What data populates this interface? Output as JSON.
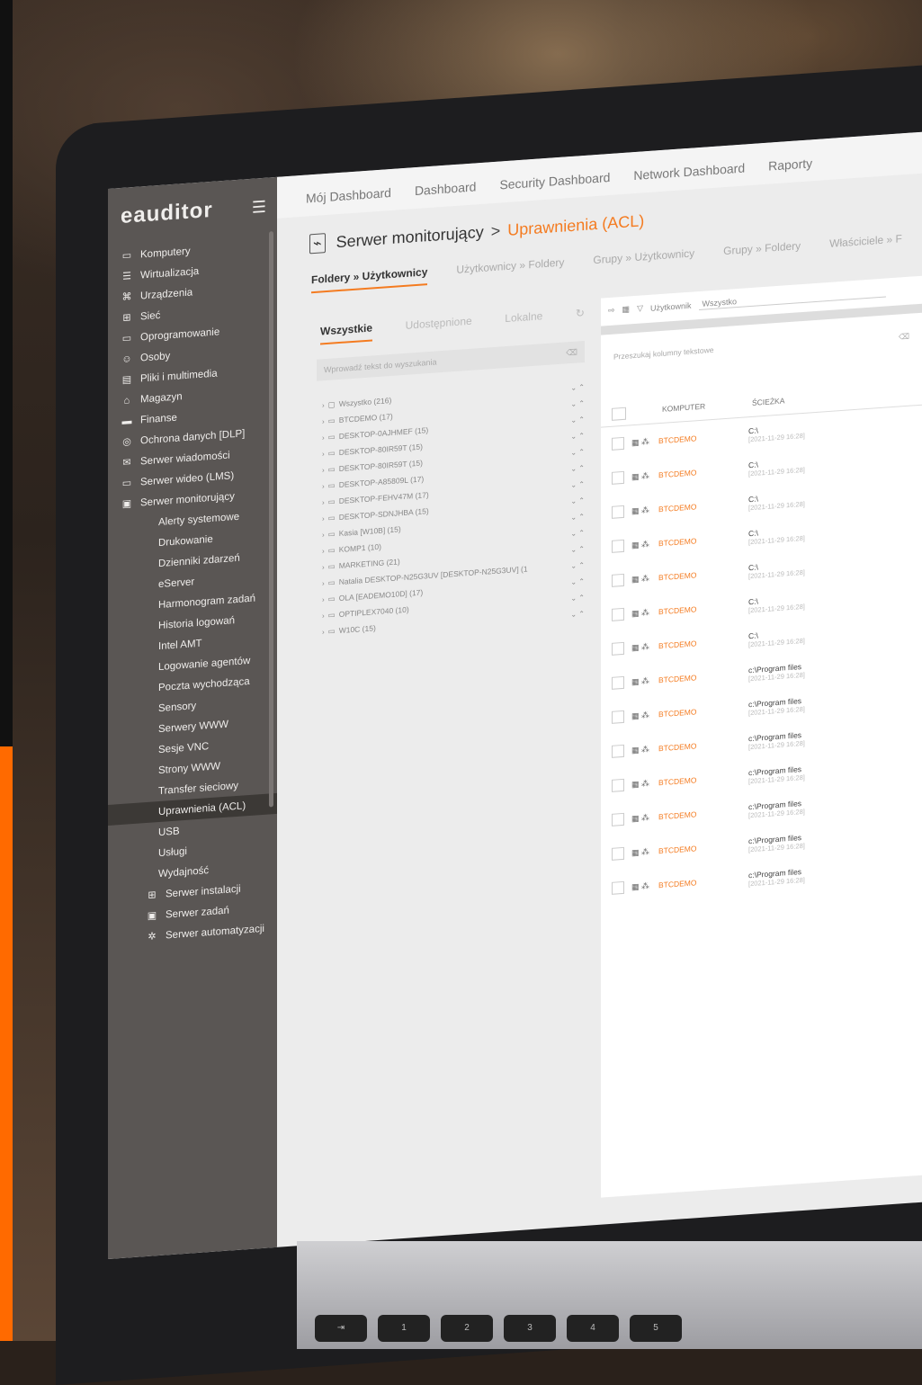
{
  "brand": {
    "name": "eauditor"
  },
  "sidebar": {
    "items": [
      {
        "label": "Komputery",
        "icon": "computer-icon",
        "glyph": "▭"
      },
      {
        "label": "Wirtualizacja",
        "icon": "server-icon",
        "glyph": "☰"
      },
      {
        "label": "Urządzenia",
        "icon": "devices-icon",
        "glyph": "⌘"
      },
      {
        "label": "Sieć",
        "icon": "network-icon",
        "glyph": "⊞"
      },
      {
        "label": "Oprogramowanie",
        "icon": "software-icon",
        "glyph": "▭"
      },
      {
        "label": "Osoby",
        "icon": "people-icon",
        "glyph": "☺"
      },
      {
        "label": "Pliki i multimedia",
        "icon": "files-icon",
        "glyph": "▤"
      },
      {
        "label": "Magazyn",
        "icon": "warehouse-icon",
        "glyph": "⌂"
      },
      {
        "label": "Finanse",
        "icon": "finance-icon",
        "glyph": "▬"
      },
      {
        "label": "Ochrona danych [DLP]",
        "icon": "shield-icon",
        "glyph": "◎"
      },
      {
        "label": "Serwer wiadomości",
        "icon": "mail-icon",
        "glyph": "✉"
      },
      {
        "label": "Serwer wideo (LMS)",
        "icon": "video-icon",
        "glyph": "▭"
      },
      {
        "label": "Serwer monitorujący",
        "icon": "monitor-icon",
        "glyph": "▣"
      }
    ],
    "sub_items": [
      "Alerty systemowe",
      "Drukowanie",
      "Dzienniki zdarzeń",
      "eServer",
      "Harmonogram zadań",
      "Historia logowań",
      "Intel AMT",
      "Logowanie agentów",
      "Poczta wychodząca",
      "Sensory",
      "Serwery WWW",
      "Sesje VNC",
      "Strony WWW",
      "Transfer sieciowy",
      "Uprawnienia (ACL)",
      "USB",
      "Usługi",
      "Wydajność"
    ],
    "active_sub": "Uprawnienia (ACL)",
    "tail_items": [
      {
        "label": "Serwer instalacji",
        "icon": "install-icon",
        "glyph": "⊞"
      },
      {
        "label": "Serwer zadań",
        "icon": "tasks-icon",
        "glyph": "▣"
      },
      {
        "label": "Serwer automatyzacji",
        "icon": "automation-icon",
        "glyph": "✲"
      }
    ]
  },
  "topnav": [
    "Mój Dashboard",
    "Dashboard",
    "Security Dashboard",
    "Network Dashboard",
    "Raporty"
  ],
  "page": {
    "section": "Serwer monitorujący",
    "separator": ">",
    "current": "Uprawnienia (ACL)"
  },
  "tabs": [
    "Foldery » Użytkownicy",
    "Użytkownicy » Foldery",
    "Grupy » Użytkownicy",
    "Grupy » Foldery",
    "Właściciele » F"
  ],
  "active_tab": 0,
  "left": {
    "subtabs": [
      "Wszystkie",
      "Udostępnione",
      "Lokalne"
    ],
    "search_placeholder": "Wprowadź tekst do wyszukania",
    "tree": [
      "Wszystko (216)",
      "BTCDEMO (17)",
      "DESKTOP-0AJHMEF (15)",
      "DESKTOP-80IR59T (15)",
      "DESKTOP-80IR59T (15)",
      "DESKTOP-A85809L (17)",
      "DESKTOP-FEHV47M (17)",
      "DESKTOP-SDNJHBA (15)",
      "Kasia [W10B] (15)",
      "KOMP1 (10)",
      "MARKETING (21)",
      "Natalia DESKTOP-N25G3UV [DESKTOP-N25G3UV] (1",
      "OLA [EADEMO10D] (17)",
      "OPTIPLEX7040 (10)",
      "W10C (15)"
    ]
  },
  "right": {
    "user_label": "Użytkownik",
    "user_value": "Wszystko",
    "search_placeholder": "Przeszukaj kolumny tekstowe",
    "columns": [
      "KOMPUTER",
      "ŚCIEŻKA"
    ],
    "rows": [
      {
        "computer": "BTCDEMO",
        "path": "C:\\",
        "date": "[2021-11-29 16:28]"
      },
      {
        "computer": "BTCDEMO",
        "path": "C:\\",
        "date": "[2021-11-29 16:28]"
      },
      {
        "computer": "BTCDEMO",
        "path": "C:\\",
        "date": "[2021-11-29 16:28]"
      },
      {
        "computer": "BTCDEMO",
        "path": "C:\\",
        "date": "[2021-11-29 16:28]"
      },
      {
        "computer": "BTCDEMO",
        "path": "C:\\",
        "date": "[2021-11-29 16:28]"
      },
      {
        "computer": "BTCDEMO",
        "path": "C:\\",
        "date": "[2021-11-29 16:28]"
      },
      {
        "computer": "BTCDEMO",
        "path": "C:\\",
        "date": "[2021-11-29 16:28]"
      },
      {
        "computer": "BTCDEMO",
        "path": "c:\\Program files",
        "date": "[2021-11-29 16:28]"
      },
      {
        "computer": "BTCDEMO",
        "path": "c:\\Program files",
        "date": "[2021-11-29 16:28]"
      },
      {
        "computer": "BTCDEMO",
        "path": "c:\\Program files",
        "date": "[2021-11-29 16:28]"
      },
      {
        "computer": "BTCDEMO",
        "path": "c:\\Program files",
        "date": "[2021-11-29 16:28]"
      },
      {
        "computer": "BTCDEMO",
        "path": "c:\\Program files",
        "date": "[2021-11-29 16:28]"
      },
      {
        "computer": "BTCDEMO",
        "path": "c:\\Program files",
        "date": "[2021-11-29 16:28]"
      },
      {
        "computer": "BTCDEMO",
        "path": "c:\\Program files",
        "date": "[2021-11-29 16:28]"
      }
    ]
  },
  "colors": {
    "accent": "#f47b20",
    "sidebar": "#5a5654",
    "brand_strip": "#ff6a00"
  }
}
